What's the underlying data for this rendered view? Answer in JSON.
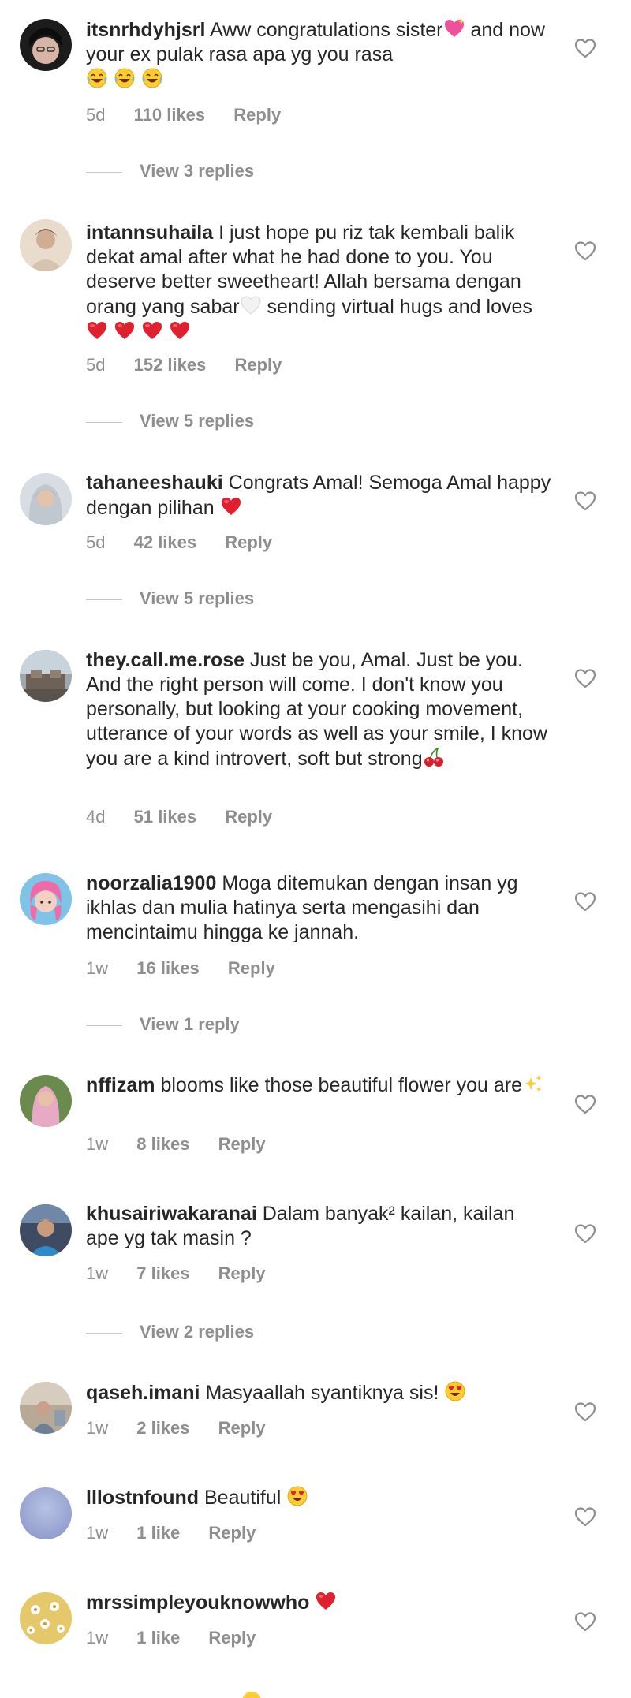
{
  "comments": [
    {
      "username": "itsnrhdyhjsrl",
      "text": "Aww congratulations sister",
      "text2": "and now your ex pulak rasa apa yg you rasa",
      "emoji": "sparkling-heart-icon",
      "emoji2": "laughing-tears-icon",
      "time": "5d",
      "likes": "110 likes",
      "reply": "Reply",
      "view_replies": "View 3 replies"
    },
    {
      "username": "intannsuhaila",
      "text": "I just hope pu riz tak kembali balik dekat amal after what he had done to you. You deserve better sweetheart! Allah bersama dengan orang yang sabar",
      "text2": "sending virtual hugs and loves",
      "emoji": "white-heart-icon",
      "emoji2": "red-heart-icon",
      "time": "5d",
      "likes": "152 likes",
      "reply": "Reply",
      "view_replies": "View 5 replies"
    },
    {
      "username": "tahaneeshauki",
      "text": "Congrats Amal! Semoga Amal happy dengan pilihan",
      "emoji": "red-heart-icon",
      "time": "5d",
      "likes": "42 likes",
      "reply": "Reply",
      "view_replies": "View 5 replies"
    },
    {
      "username": "they.call.me.rose",
      "text": "Just be you, Amal. Just be you. And the right person will come. I don't know you personally, but looking at your cooking movement, utterance of your words as well as your smile, I know you are a kind introvert, soft but strong",
      "emoji": "cherries-icon",
      "time": "4d",
      "likes": "51 likes",
      "reply": "Reply"
    },
    {
      "username": "noorzalia1900",
      "text": "Moga ditemukan dengan insan yg ikhlas dan mulia hatinya serta mengasihi dan mencintaimu hingga ke jannah.",
      "time": "1w",
      "likes": "16 likes",
      "reply": "Reply",
      "view_replies": "View 1 reply"
    },
    {
      "username": "nffizam",
      "text": "blooms like those beautiful flower you are",
      "emoji": "sparkles-icon",
      "time": "1w",
      "likes": "8 likes",
      "reply": "Reply"
    },
    {
      "username": "khusairiwakaranai",
      "text": "Dalam banyak² kailan, kailan ape yg tak masin ?",
      "time": "1w",
      "likes": "7 likes",
      "reply": "Reply",
      "view_replies": "View 2 replies"
    },
    {
      "username": "qaseh.imani",
      "text": "Masyaallah syantiknya sis!",
      "emoji": "heart-eyes-icon",
      "time": "1w",
      "likes": "2 likes",
      "reply": "Reply"
    },
    {
      "username": "lllostnfound",
      "text": "Beautiful",
      "emoji": "heart-eyes-icon",
      "time": "1w",
      "likes": "1 like",
      "reply": "Reply"
    },
    {
      "username": "mrssimpleyouknowwho",
      "text": "",
      "emoji": "red-heart-icon",
      "time": "1w",
      "likes": "1 like",
      "reply": "Reply"
    }
  ],
  "colors": {
    "text": "#262626",
    "muted": "#8e8e8e",
    "divider": "#c7c7c7",
    "heart_red": "#e0202e"
  }
}
